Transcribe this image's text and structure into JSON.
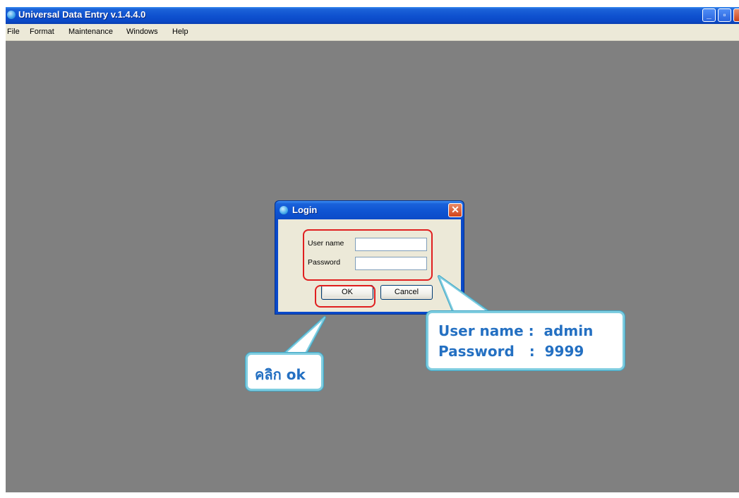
{
  "app": {
    "title": "Universal Data Entry v.1.4.4.0",
    "window_buttons": {
      "minimize": "_",
      "restore": "▫",
      "close": "✕"
    }
  },
  "menu": [
    "File",
    "Format",
    "Maintenance",
    "Windows",
    "Help"
  ],
  "login_dialog": {
    "title": "Login",
    "close_glyph": "✕",
    "username_label": "User name",
    "username_value": "",
    "password_label": "Password",
    "password_value": "",
    "ok_label": "OK",
    "cancel_label": "Cancel"
  },
  "callouts": {
    "credentials_line1": "User name :  admin",
    "credentials_line2": "Password   :  9999",
    "click_ok": "คลิก ok"
  },
  "colors": {
    "titlebar_blue": "#0f52d0",
    "workspace_gray": "#808080",
    "highlight_red": "#e01f1f",
    "callout_text": "#2470c2",
    "callout_border": "#7fcde0"
  }
}
